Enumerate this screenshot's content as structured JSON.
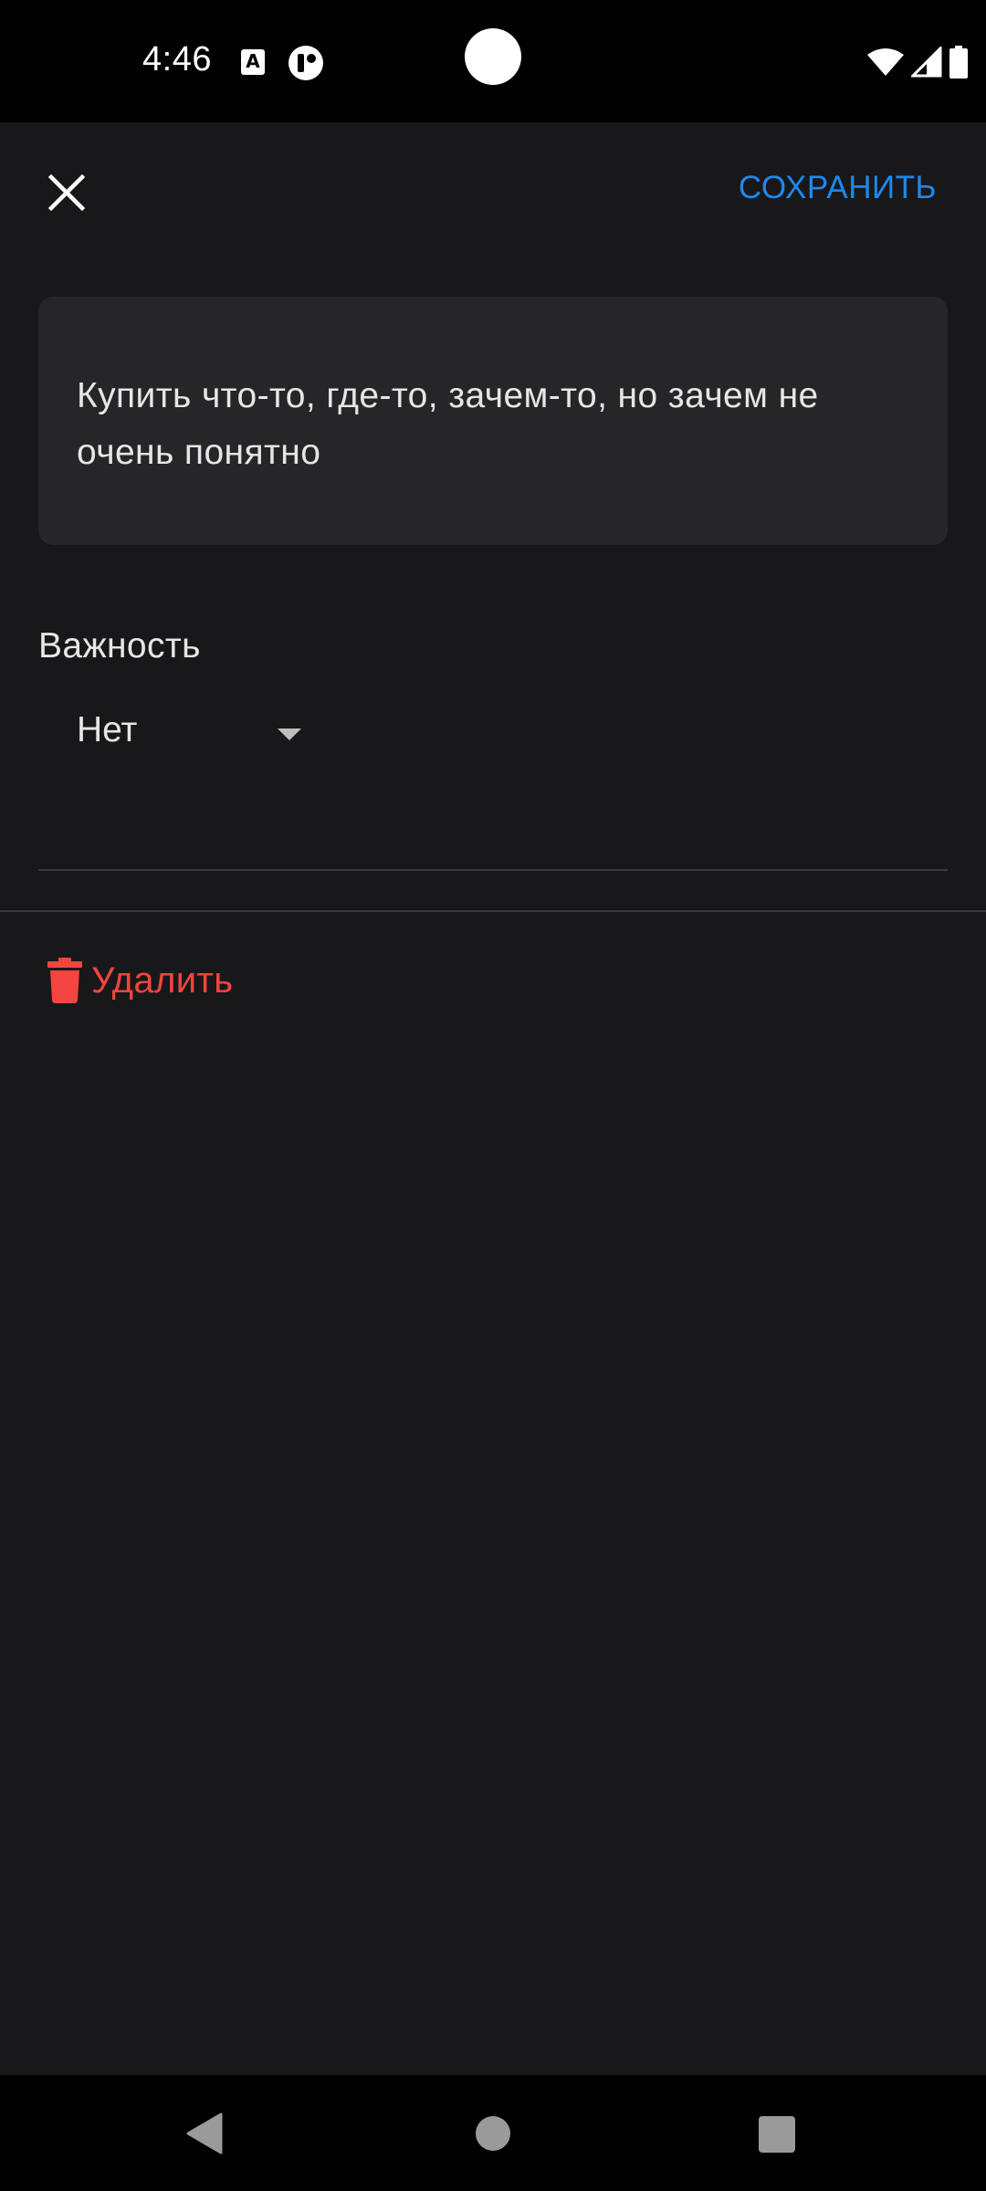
{
  "status_bar": {
    "time": "4:46",
    "icons": [
      "translate-a-icon",
      "app-t-icon",
      "wifi-icon",
      "signal-icon",
      "battery-icon"
    ]
  },
  "app_bar": {
    "close_icon": "close-icon",
    "save_label": "СОХРАНИТЬ"
  },
  "task": {
    "text": "Купить что-то, где-то, зачем-то, но зачем не очень понятно"
  },
  "importance": {
    "label": "Важность",
    "selected": "Нет"
  },
  "delete": {
    "label": "Удалить",
    "icon": "trash-icon"
  },
  "nav_bar": {
    "icons": [
      "back-icon",
      "home-icon",
      "recents-icon"
    ]
  },
  "colors": {
    "background": "#18181a",
    "card": "#262628",
    "accent": "#1e88f0",
    "danger": "#f2453d",
    "text": "#e6e6e6"
  }
}
